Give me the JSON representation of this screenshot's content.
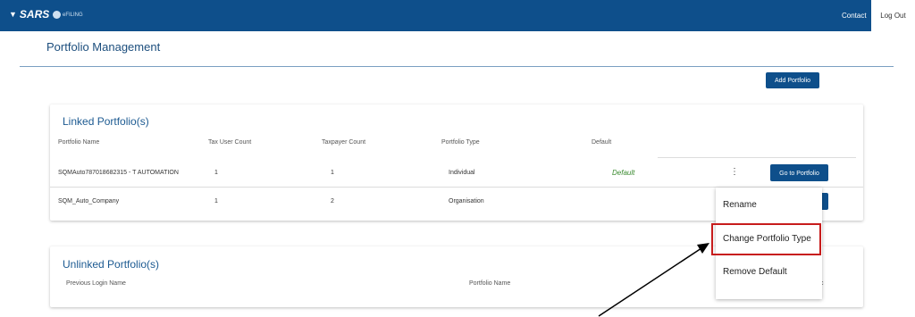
{
  "header": {
    "brand": "SARS",
    "efiling": "eFILING",
    "contact_label": "Contact",
    "logout_label": "Log Out",
    "background": "#0e4f8b"
  },
  "page": {
    "title": "Portfolio Management",
    "add_button": "Add Portfolio"
  },
  "linked": {
    "title": "Linked Portfolio(s)",
    "columns": [
      "Portfolio Name",
      "Tax User Count",
      "Taxpayer Count",
      "Portfolio Type",
      "Default"
    ],
    "rows": [
      {
        "name": "SQMAuto787018682315 - T AUTOMATION",
        "tax_user_count": "1",
        "taxpayer_count": "1",
        "type": "Individual",
        "default": "Default",
        "action": "Go to Portfolio"
      },
      {
        "name": "SQM_Auto_Company",
        "tax_user_count": "1",
        "taxpayer_count": "2",
        "type": "Organisation",
        "default": "",
        "action": ""
      }
    ]
  },
  "menu": {
    "items": [
      "Rename",
      "Change Portfolio Type",
      "Remove Default"
    ],
    "highlight_color": "#c71c1c"
  },
  "unlinked": {
    "title": "Unlinked Portfolio(s)",
    "columns": [
      "Previous Login Name",
      "Portfolio Name"
    ],
    "fragment": "c"
  }
}
